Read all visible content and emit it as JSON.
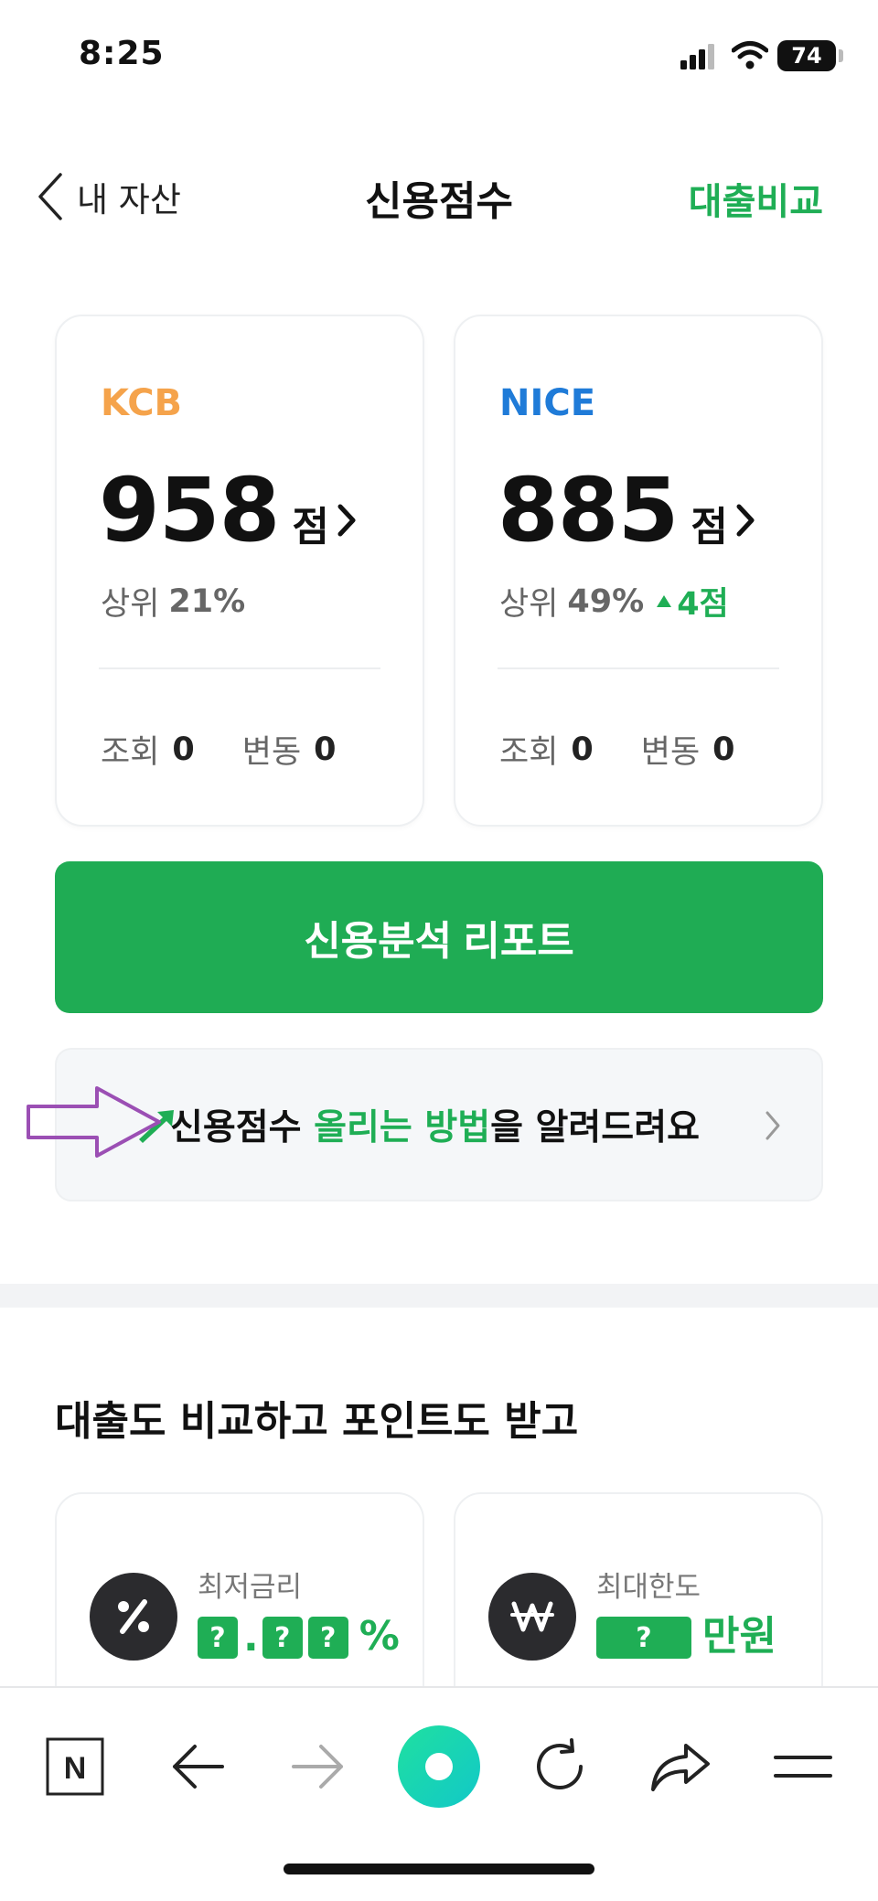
{
  "status_bar": {
    "time": "8:25",
    "battery": "74"
  },
  "header": {
    "back_label": "내 자산",
    "title": "신용점수",
    "right_link": "대출비교"
  },
  "score_cards": [
    {
      "bureau": "KCB",
      "bureau_color": "#f5a34b",
      "score": "958",
      "unit": "점",
      "rank_label": "상위",
      "rank_value": "21%",
      "inquiry_label": "조회",
      "inquiry_value": "0",
      "change_label": "변동",
      "change_value": "0"
    },
    {
      "bureau": "NICE",
      "bureau_color": "#1f7bd8",
      "score": "885",
      "unit": "점",
      "rank_label": "상위",
      "rank_value": "49%",
      "rank_change": "4점",
      "inquiry_label": "조회",
      "inquiry_value": "0",
      "change_label": "변동",
      "change_value": "0"
    }
  ],
  "report_button": {
    "label": "신용분석 리포트"
  },
  "tip_banner": {
    "text_part1": "신용점수 ",
    "text_green": "올리는 방법",
    "text_part2": "을 알려드려요"
  },
  "loan_section": {
    "heading": "대출도 비교하고 포인트도 받고",
    "cards": [
      {
        "label": "최저금리",
        "icon": "percent-icon",
        "mask": "?",
        "separator": ".",
        "suffix": "%"
      },
      {
        "label": "최대한도",
        "icon": "won-icon",
        "mask": "?",
        "suffix": "만원"
      }
    ]
  },
  "bottom_toolbar": {
    "icons": [
      "naver-n-icon",
      "back-arrow-icon",
      "forward-arrow-icon",
      "home-circle-icon",
      "refresh-icon",
      "share-icon",
      "menu-icon"
    ],
    "naver_letter": "N"
  },
  "colors": {
    "accent_green": "#1fac54",
    "annotation_purple": "#9b4fb4"
  }
}
